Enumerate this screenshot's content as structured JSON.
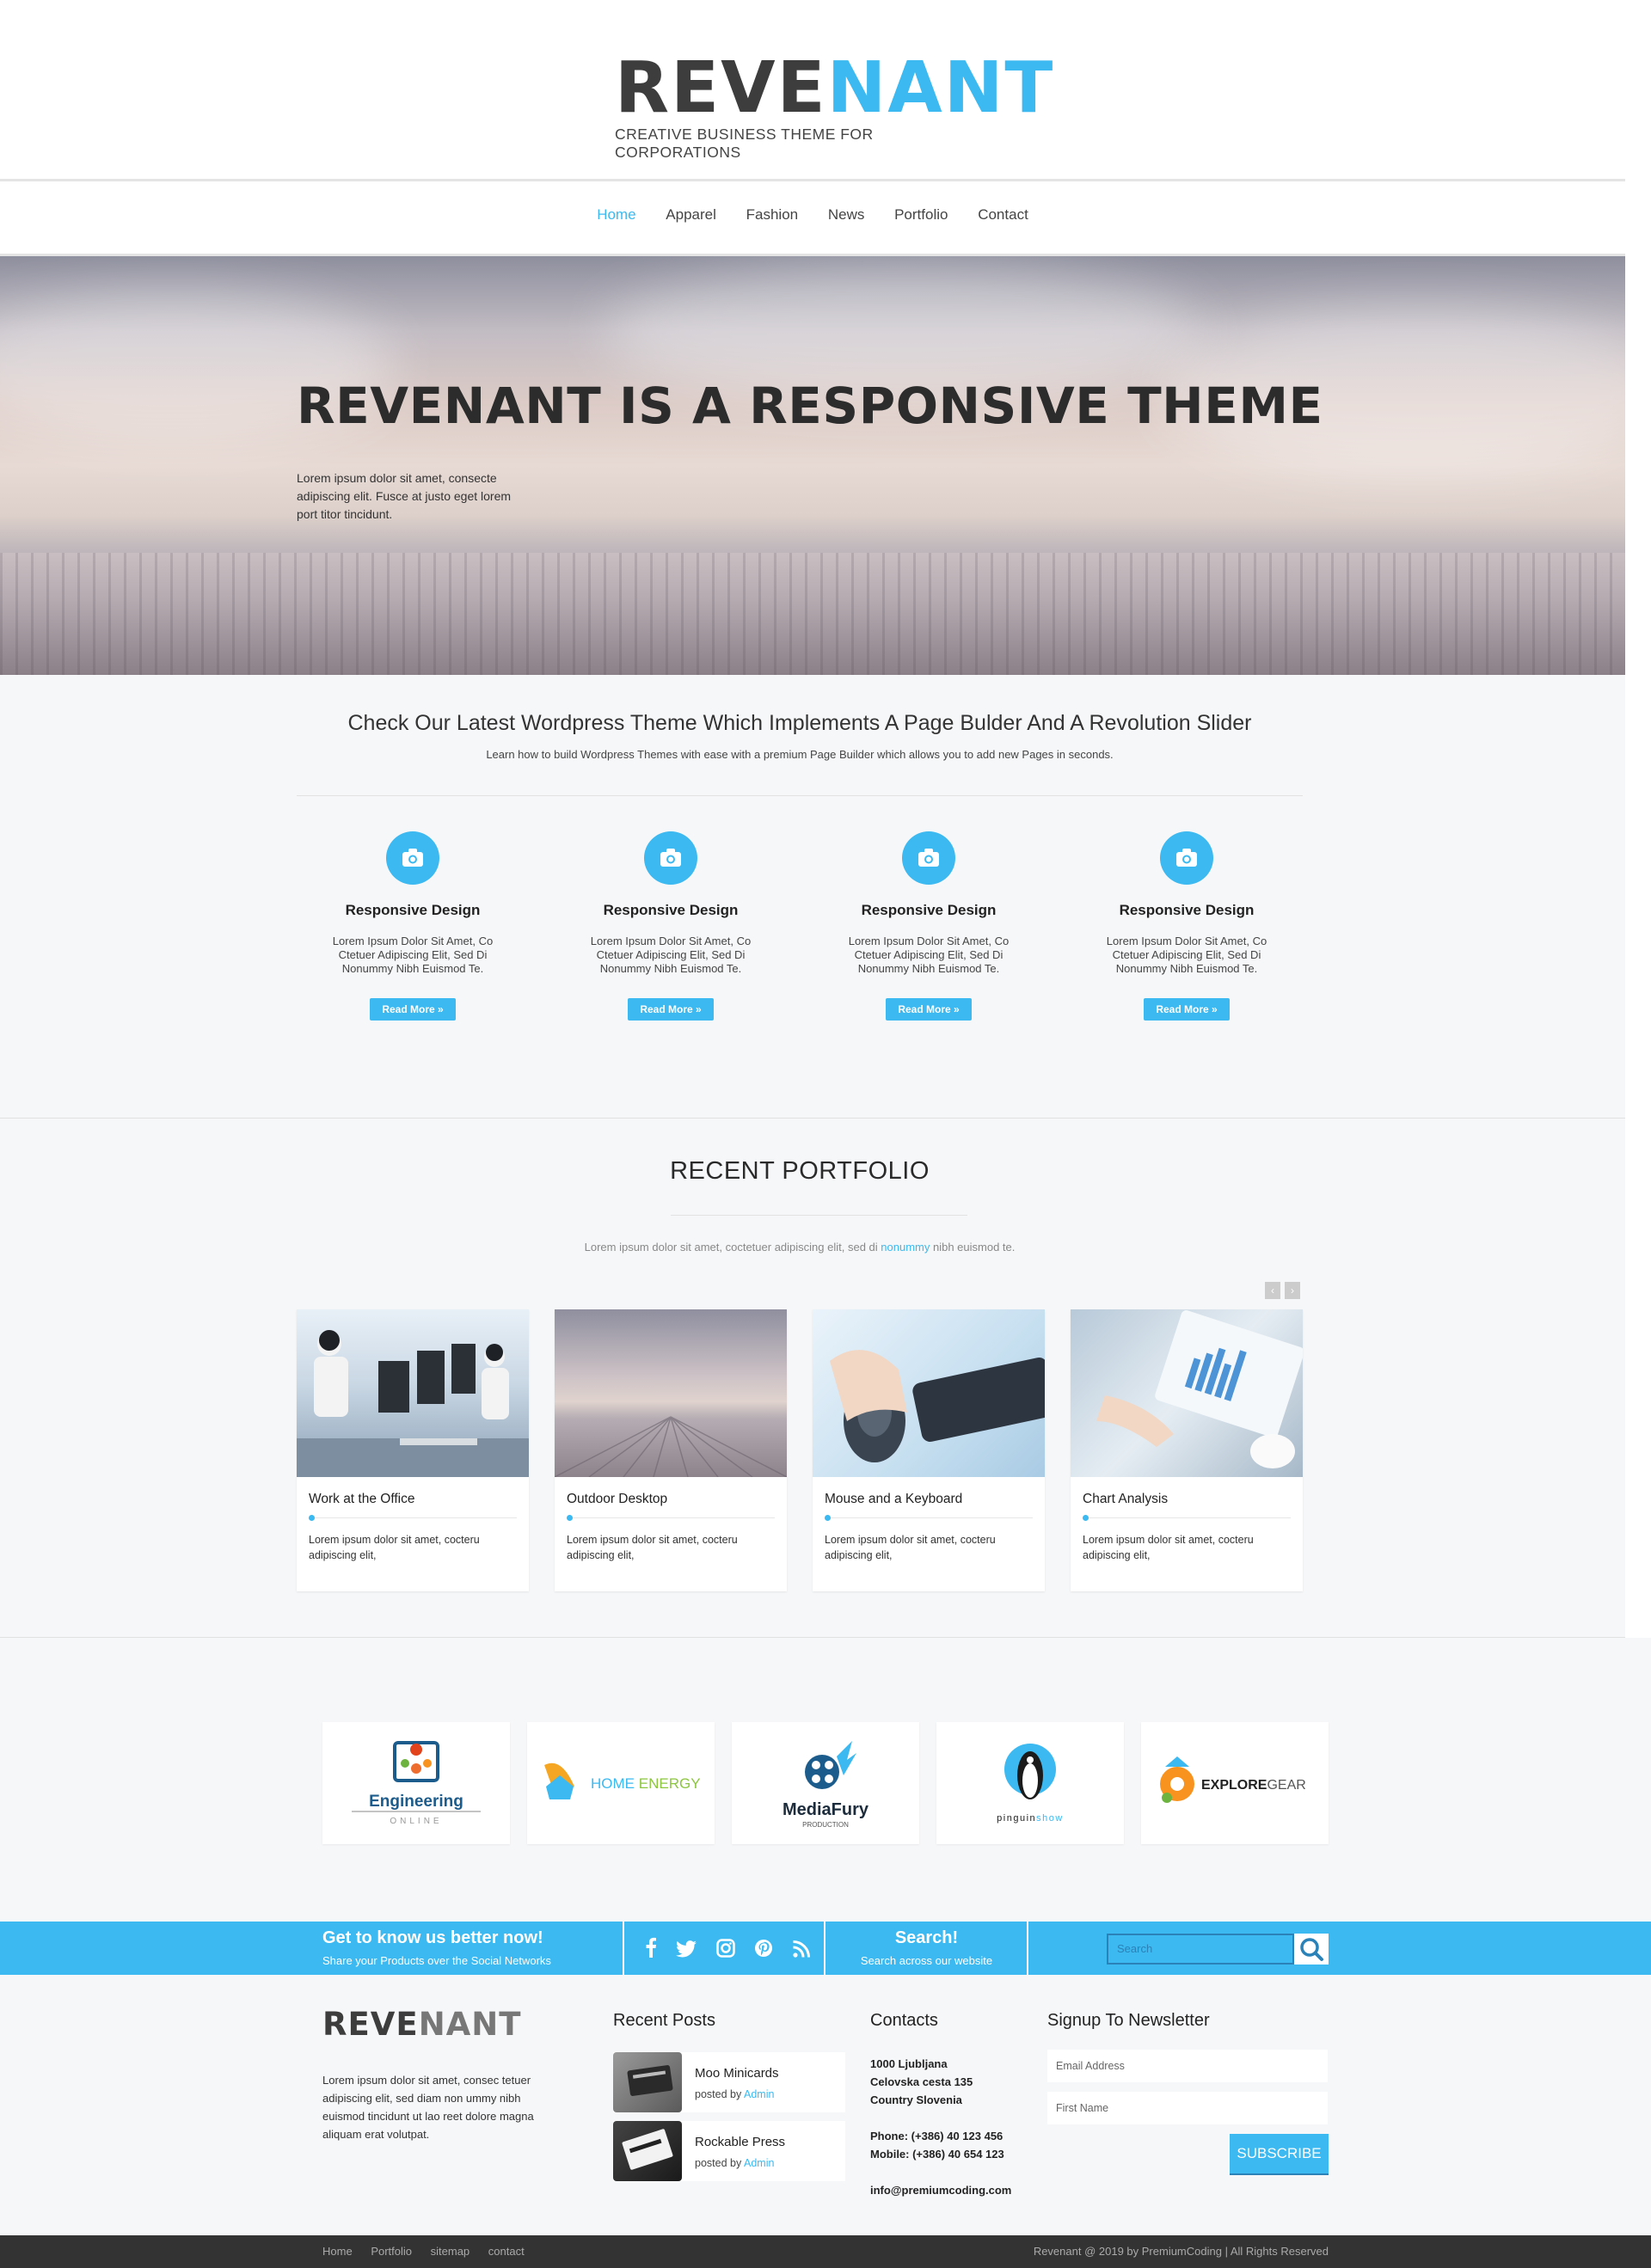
{
  "header": {
    "logo": {
      "part1": "REVE",
      "part2": "NANT",
      "tagline": "CREATIVE BUSINESS THEME FOR CORPORATIONS"
    },
    "nav": [
      {
        "label": "Home",
        "active": true
      },
      {
        "label": "Apparel"
      },
      {
        "label": "Fashion"
      },
      {
        "label": "News"
      },
      {
        "label": "Portfolio"
      },
      {
        "label": "Contact"
      }
    ]
  },
  "hero": {
    "title": "REVENANT IS A RESPONSIVE THEME",
    "text": "Lorem ipsum dolor sit amet, consecte adipiscing elit. Fusce at justo eget lorem port titor tincidunt."
  },
  "intro": {
    "title": "Check Our Latest Wordpress Theme Which Implements A Page Bulder And A Revolution Slider",
    "subtitle": "Learn how to build Wordpress Themes with ease with a premium Page Builder which allows you to add new Pages in seconds.",
    "features": [
      {
        "icon": "camera-icon",
        "title": "Responsive Design",
        "text": "Lorem Ipsum Dolor Sit Amet, Co Ctetuer Adipiscing Elit, Sed Di Nonummy Nibh Euismod Te.",
        "button": "Read More »"
      },
      {
        "icon": "camera-icon",
        "title": "Responsive Design",
        "text": "Lorem Ipsum Dolor Sit Amet, Co Ctetuer Adipiscing Elit, Sed Di Nonummy Nibh Euismod Te.",
        "button": "Read More »"
      },
      {
        "icon": "camera-icon",
        "title": "Responsive Design",
        "text": "Lorem Ipsum Dolor Sit Amet, Co Ctetuer Adipiscing Elit, Sed Di Nonummy Nibh Euismod Te.",
        "button": "Read More »"
      },
      {
        "icon": "camera-icon",
        "title": "Responsive Design",
        "text": "Lorem Ipsum Dolor Sit Amet, Co Ctetuer Adipiscing Elit, Sed Di Nonummy Nibh Euismod Te.",
        "button": "Read More »"
      }
    ]
  },
  "portfolio": {
    "title": "RECENT PORTFOLIO",
    "subtitle_before": "Lorem ipsum dolor sit amet, coctetuer adipiscing elit, sed di ",
    "subtitle_link": "nonummy",
    "subtitle_after": " nibh euismod te.",
    "prev": "‹",
    "next": "›",
    "items": [
      {
        "title": "Work at the Office",
        "text": "Lorem ipsum dolor sit amet, cocteru adipiscing elit,"
      },
      {
        "title": "Outdoor Desktop",
        "text": "Lorem ipsum dolor sit amet, cocteru adipiscing elit,"
      },
      {
        "title": "Mouse and a Keyboard",
        "text": "Lorem ipsum dolor sit amet, cocteru adipiscing elit,"
      },
      {
        "title": "Chart Analysis",
        "text": "Lorem ipsum dolor sit amet, cocteru adipiscing elit,"
      }
    ]
  },
  "clients": [
    {
      "name": "Engineering",
      "sub": "ONLINE"
    },
    {
      "name": "HOME ENERGY",
      "part1": "HOME ",
      "part2": "ENERGY"
    },
    {
      "name": "MediaFury",
      "sub": "PRODUCTION"
    },
    {
      "name": "pinguinshow",
      "part1": "pinguin",
      "part2": "show"
    },
    {
      "name": "EXPLOREGEAR",
      "part1": "EXPLORE",
      "part2": "GEAR"
    }
  ],
  "social_bar": {
    "heading": "Get to know us better now!",
    "text": "Share your Products over the Social Networks",
    "icons": [
      "facebook-icon",
      "twitter-icon",
      "instagram-icon",
      "pinterest-icon",
      "rss-icon"
    ],
    "search_heading": "Search!",
    "search_text": "Search across our website",
    "search_placeholder": "Search"
  },
  "footer": {
    "logo": {
      "part1": "REVE",
      "part2": "NANT"
    },
    "about": "Lorem ipsum dolor sit amet, consec tetuer adipiscing elit, sed diam non ummy nibh euismod tincidunt ut lao reet dolore magna aliquam erat volutpat.",
    "recent_posts_heading": "Recent Posts",
    "posts": [
      {
        "title": "Moo Minicards",
        "by": "posted by ",
        "author": "Admin"
      },
      {
        "title": "Rockable Press",
        "by": "posted by ",
        "author": "Admin"
      }
    ],
    "contacts_heading": "Contacts",
    "contacts": {
      "line1": "1000 Ljubljana",
      "line2": "Celovska cesta 135",
      "line3": "Country Slovenia",
      "phone": "Phone: (+386) 40 123 456",
      "mobile": "Mobile: (+386) 40 654 123",
      "email": "info@premiumcoding.com"
    },
    "newsletter_heading": "Signup To Newsletter",
    "email_placeholder": "Email Address",
    "name_placeholder": "First Name",
    "subscribe": "SUBSCRIBE"
  },
  "bottom": {
    "links": [
      "Home",
      "Portfolio",
      "sitemap",
      "contact"
    ],
    "copyright": "Revenant @ 2019 by PremiumCoding | All Rights Reserved"
  },
  "colors": {
    "accent": "#3bb9f0",
    "dark": "#333333",
    "background": "#f6f7f9"
  }
}
